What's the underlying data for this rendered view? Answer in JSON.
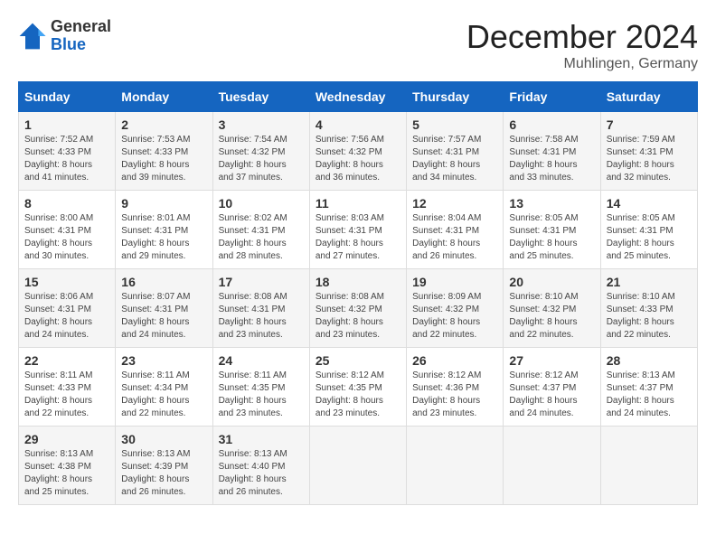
{
  "header": {
    "logo_general": "General",
    "logo_blue": "Blue",
    "month_title": "December 2024",
    "location": "Muhlingen, Germany"
  },
  "weekdays": [
    "Sunday",
    "Monday",
    "Tuesday",
    "Wednesday",
    "Thursday",
    "Friday",
    "Saturday"
  ],
  "weeks": [
    [
      {
        "day": "1",
        "rise": "Sunrise: 7:52 AM",
        "set": "Sunset: 4:33 PM",
        "daylight": "Daylight: 8 hours and 41 minutes."
      },
      {
        "day": "2",
        "rise": "Sunrise: 7:53 AM",
        "set": "Sunset: 4:33 PM",
        "daylight": "Daylight: 8 hours and 39 minutes."
      },
      {
        "day": "3",
        "rise": "Sunrise: 7:54 AM",
        "set": "Sunset: 4:32 PM",
        "daylight": "Daylight: 8 hours and 37 minutes."
      },
      {
        "day": "4",
        "rise": "Sunrise: 7:56 AM",
        "set": "Sunset: 4:32 PM",
        "daylight": "Daylight: 8 hours and 36 minutes."
      },
      {
        "day": "5",
        "rise": "Sunrise: 7:57 AM",
        "set": "Sunset: 4:31 PM",
        "daylight": "Daylight: 8 hours and 34 minutes."
      },
      {
        "day": "6",
        "rise": "Sunrise: 7:58 AM",
        "set": "Sunset: 4:31 PM",
        "daylight": "Daylight: 8 hours and 33 minutes."
      },
      {
        "day": "7",
        "rise": "Sunrise: 7:59 AM",
        "set": "Sunset: 4:31 PM",
        "daylight": "Daylight: 8 hours and 32 minutes."
      }
    ],
    [
      {
        "day": "8",
        "rise": "Sunrise: 8:00 AM",
        "set": "Sunset: 4:31 PM",
        "daylight": "Daylight: 8 hours and 30 minutes."
      },
      {
        "day": "9",
        "rise": "Sunrise: 8:01 AM",
        "set": "Sunset: 4:31 PM",
        "daylight": "Daylight: 8 hours and 29 minutes."
      },
      {
        "day": "10",
        "rise": "Sunrise: 8:02 AM",
        "set": "Sunset: 4:31 PM",
        "daylight": "Daylight: 8 hours and 28 minutes."
      },
      {
        "day": "11",
        "rise": "Sunrise: 8:03 AM",
        "set": "Sunset: 4:31 PM",
        "daylight": "Daylight: 8 hours and 27 minutes."
      },
      {
        "day": "12",
        "rise": "Sunrise: 8:04 AM",
        "set": "Sunset: 4:31 PM",
        "daylight": "Daylight: 8 hours and 26 minutes."
      },
      {
        "day": "13",
        "rise": "Sunrise: 8:05 AM",
        "set": "Sunset: 4:31 PM",
        "daylight": "Daylight: 8 hours and 25 minutes."
      },
      {
        "day": "14",
        "rise": "Sunrise: 8:05 AM",
        "set": "Sunset: 4:31 PM",
        "daylight": "Daylight: 8 hours and 25 minutes."
      }
    ],
    [
      {
        "day": "15",
        "rise": "Sunrise: 8:06 AM",
        "set": "Sunset: 4:31 PM",
        "daylight": "Daylight: 8 hours and 24 minutes."
      },
      {
        "day": "16",
        "rise": "Sunrise: 8:07 AM",
        "set": "Sunset: 4:31 PM",
        "daylight": "Daylight: 8 hours and 24 minutes."
      },
      {
        "day": "17",
        "rise": "Sunrise: 8:08 AM",
        "set": "Sunset: 4:31 PM",
        "daylight": "Daylight: 8 hours and 23 minutes."
      },
      {
        "day": "18",
        "rise": "Sunrise: 8:08 AM",
        "set": "Sunset: 4:32 PM",
        "daylight": "Daylight: 8 hours and 23 minutes."
      },
      {
        "day": "19",
        "rise": "Sunrise: 8:09 AM",
        "set": "Sunset: 4:32 PM",
        "daylight": "Daylight: 8 hours and 22 minutes."
      },
      {
        "day": "20",
        "rise": "Sunrise: 8:10 AM",
        "set": "Sunset: 4:32 PM",
        "daylight": "Daylight: 8 hours and 22 minutes."
      },
      {
        "day": "21",
        "rise": "Sunrise: 8:10 AM",
        "set": "Sunset: 4:33 PM",
        "daylight": "Daylight: 8 hours and 22 minutes."
      }
    ],
    [
      {
        "day": "22",
        "rise": "Sunrise: 8:11 AM",
        "set": "Sunset: 4:33 PM",
        "daylight": "Daylight: 8 hours and 22 minutes."
      },
      {
        "day": "23",
        "rise": "Sunrise: 8:11 AM",
        "set": "Sunset: 4:34 PM",
        "daylight": "Daylight: 8 hours and 22 minutes."
      },
      {
        "day": "24",
        "rise": "Sunrise: 8:11 AM",
        "set": "Sunset: 4:35 PM",
        "daylight": "Daylight: 8 hours and 23 minutes."
      },
      {
        "day": "25",
        "rise": "Sunrise: 8:12 AM",
        "set": "Sunset: 4:35 PM",
        "daylight": "Daylight: 8 hours and 23 minutes."
      },
      {
        "day": "26",
        "rise": "Sunrise: 8:12 AM",
        "set": "Sunset: 4:36 PM",
        "daylight": "Daylight: 8 hours and 23 minutes."
      },
      {
        "day": "27",
        "rise": "Sunrise: 8:12 AM",
        "set": "Sunset: 4:37 PM",
        "daylight": "Daylight: 8 hours and 24 minutes."
      },
      {
        "day": "28",
        "rise": "Sunrise: 8:13 AM",
        "set": "Sunset: 4:37 PM",
        "daylight": "Daylight: 8 hours and 24 minutes."
      }
    ],
    [
      {
        "day": "29",
        "rise": "Sunrise: 8:13 AM",
        "set": "Sunset: 4:38 PM",
        "daylight": "Daylight: 8 hours and 25 minutes."
      },
      {
        "day": "30",
        "rise": "Sunrise: 8:13 AM",
        "set": "Sunset: 4:39 PM",
        "daylight": "Daylight: 8 hours and 26 minutes."
      },
      {
        "day": "31",
        "rise": "Sunrise: 8:13 AM",
        "set": "Sunset: 4:40 PM",
        "daylight": "Daylight: 8 hours and 26 minutes."
      },
      null,
      null,
      null,
      null
    ]
  ]
}
